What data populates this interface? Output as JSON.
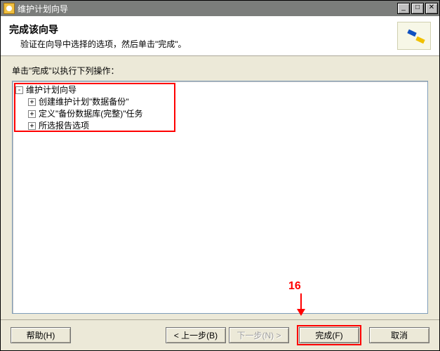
{
  "window": {
    "title": "维护计划向导"
  },
  "header": {
    "title": "完成该向导",
    "subtitle": "验证在向导中选择的选项，然后单击\"完成\"。"
  },
  "body": {
    "instruction": "单击\"完成\"以执行下列操作："
  },
  "tree": {
    "root_label": "维护计划向导",
    "children": [
      {
        "label": "创建维护计划\"数据备份\""
      },
      {
        "label": "定义\"备份数据库(完整)\"任务"
      },
      {
        "label": "所选报告选项"
      }
    ]
  },
  "buttons": {
    "help": "帮助(H)",
    "back": "< 上一步(B)",
    "next": "下一步(N) >",
    "finish": "完成(F)",
    "cancel": "取消"
  },
  "titlebar_buttons": {
    "min": "_",
    "max": "□",
    "close": "✕"
  },
  "annotation": {
    "step_number": "16"
  }
}
